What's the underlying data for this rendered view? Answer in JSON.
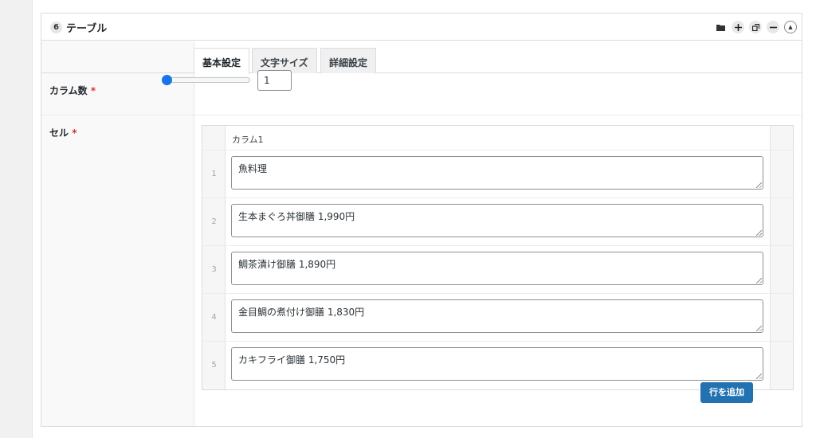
{
  "panel": {
    "number": "6",
    "title": "テーブル",
    "icons": [
      "folder-icon",
      "plus-icon",
      "duplicate-icon",
      "minus-icon",
      "collapse-up-icon"
    ]
  },
  "tabs": [
    {
      "label": "基本設定",
      "active": true
    },
    {
      "label": "文字サイズ",
      "active": false
    },
    {
      "label": "詳細設定",
      "active": false
    }
  ],
  "fields": {
    "columns": {
      "label": "カラム数",
      "required": "*",
      "value": "1",
      "slider_level": 0
    },
    "cells": {
      "label": "セル",
      "required": "*"
    }
  },
  "table": {
    "header": "カラム1",
    "rows": [
      {
        "num": "1",
        "value": "魚料理"
      },
      {
        "num": "2",
        "value": "生本まぐろ丼御膳 1,990円"
      },
      {
        "num": "3",
        "value": "鯛茶漬け御膳 1,890円"
      },
      {
        "num": "4",
        "value": "金目鯛の煮付け御膳 1,830円"
      },
      {
        "num": "5",
        "value": "カキフライ御膳 1,750円"
      }
    ]
  },
  "buttons": {
    "add_row": "行を追加"
  },
  "colors": {
    "accent": "#2271b1",
    "slider": "#1a73e8",
    "required": "#d63638"
  }
}
